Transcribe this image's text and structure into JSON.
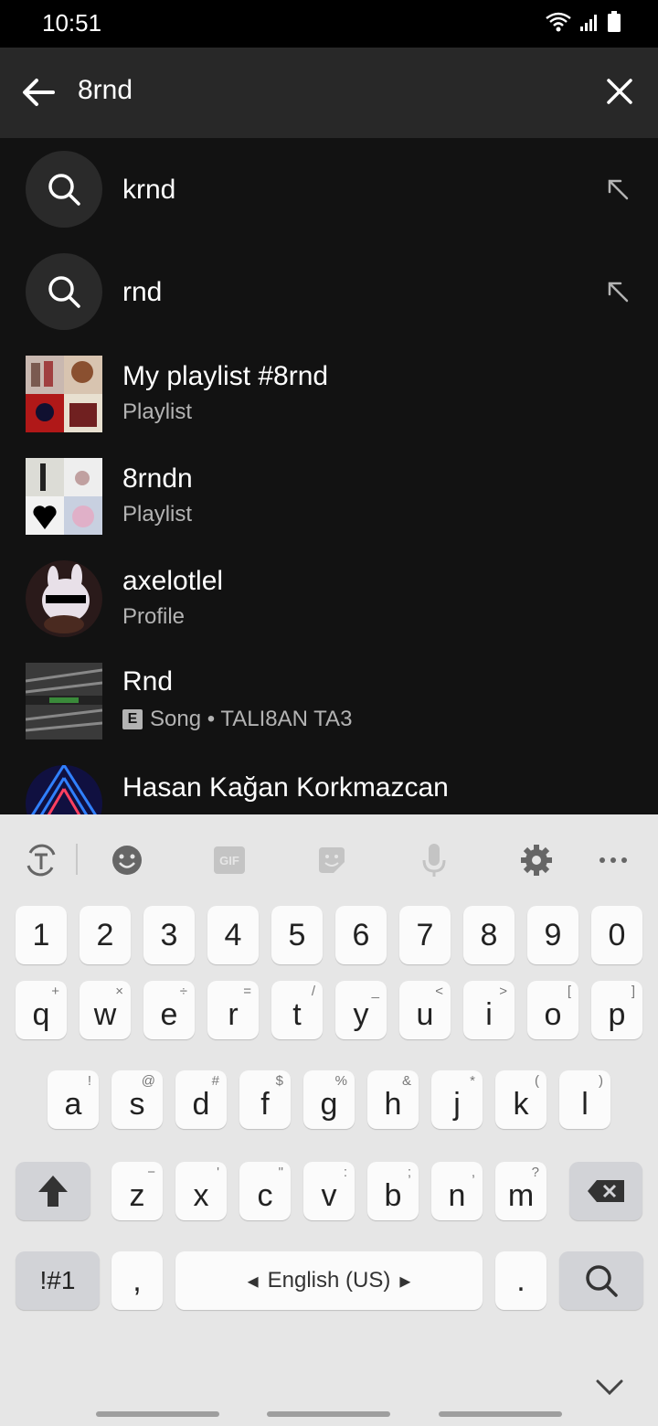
{
  "status_bar": {
    "time": "10:51"
  },
  "search": {
    "query": "8rnd"
  },
  "results": [
    {
      "kind": "suggestion",
      "title": "krnd"
    },
    {
      "kind": "suggestion",
      "title": "rnd"
    },
    {
      "kind": "playlist",
      "title": "My playlist #8rnd",
      "subtitle": "Playlist"
    },
    {
      "kind": "playlist",
      "title": "8rndn",
      "subtitle": "Playlist"
    },
    {
      "kind": "profile",
      "title": "axelotlel",
      "subtitle": "Profile"
    },
    {
      "kind": "song",
      "title": "Rnd",
      "explicit": "E",
      "subtitle": "Song • TALI8AN TA3"
    },
    {
      "kind": "artist",
      "title": "Hasan Kağan Korkmazcan"
    }
  ],
  "keyboard": {
    "toolbar": [
      "text-mode-icon",
      "emoji-icon",
      "gif-icon",
      "sticker-icon",
      "mic-icon",
      "gear-icon",
      "more-icon"
    ],
    "gif_label": "GIF",
    "numbers": [
      "1",
      "2",
      "3",
      "4",
      "5",
      "6",
      "7",
      "8",
      "9",
      "0"
    ],
    "row1": [
      [
        "q",
        "+"
      ],
      [
        "w",
        "×"
      ],
      [
        "e",
        "÷"
      ],
      [
        "r",
        "="
      ],
      [
        "t",
        "/"
      ],
      [
        "y",
        "_"
      ],
      [
        "u",
        "<"
      ],
      [
        "i",
        ">"
      ],
      [
        "o",
        "["
      ],
      [
        "p",
        "]"
      ]
    ],
    "row2": [
      [
        "a",
        "!"
      ],
      [
        "s",
        "@"
      ],
      [
        "d",
        "#"
      ],
      [
        "f",
        "$"
      ],
      [
        "g",
        "%"
      ],
      [
        "h",
        "&"
      ],
      [
        "j",
        "*"
      ],
      [
        "k",
        "("
      ],
      [
        "l",
        ")"
      ]
    ],
    "row3": [
      [
        "z",
        "−"
      ],
      [
        "x",
        "'"
      ],
      [
        "c",
        "\""
      ],
      [
        "v",
        ":"
      ],
      [
        "b",
        ";"
      ],
      [
        "n",
        ","
      ],
      [
        "m",
        "?"
      ]
    ],
    "symbols_label": "!#1",
    "comma": ",",
    "space_label": "English (US)",
    "period": "."
  }
}
